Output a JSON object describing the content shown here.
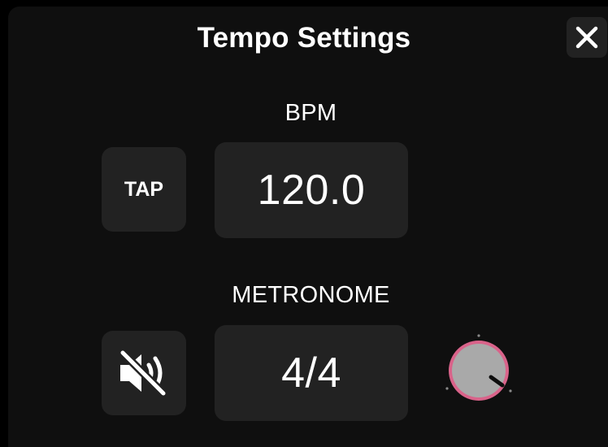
{
  "dialog": {
    "title": "Tempo Settings",
    "close_icon": "close-icon"
  },
  "bpm": {
    "label": "BPM",
    "tap_label": "TAP",
    "value": "120.0"
  },
  "metronome": {
    "label": "METRONOME",
    "mute_icon": "speaker-muted-icon",
    "time_signature": "4/4",
    "volume_knob": {
      "ring_color": "#d9638a"
    }
  },
  "colors": {
    "background": "#0f0f0f",
    "button": "#222222",
    "text": "#ffffff",
    "accent": "#d9638a"
  }
}
